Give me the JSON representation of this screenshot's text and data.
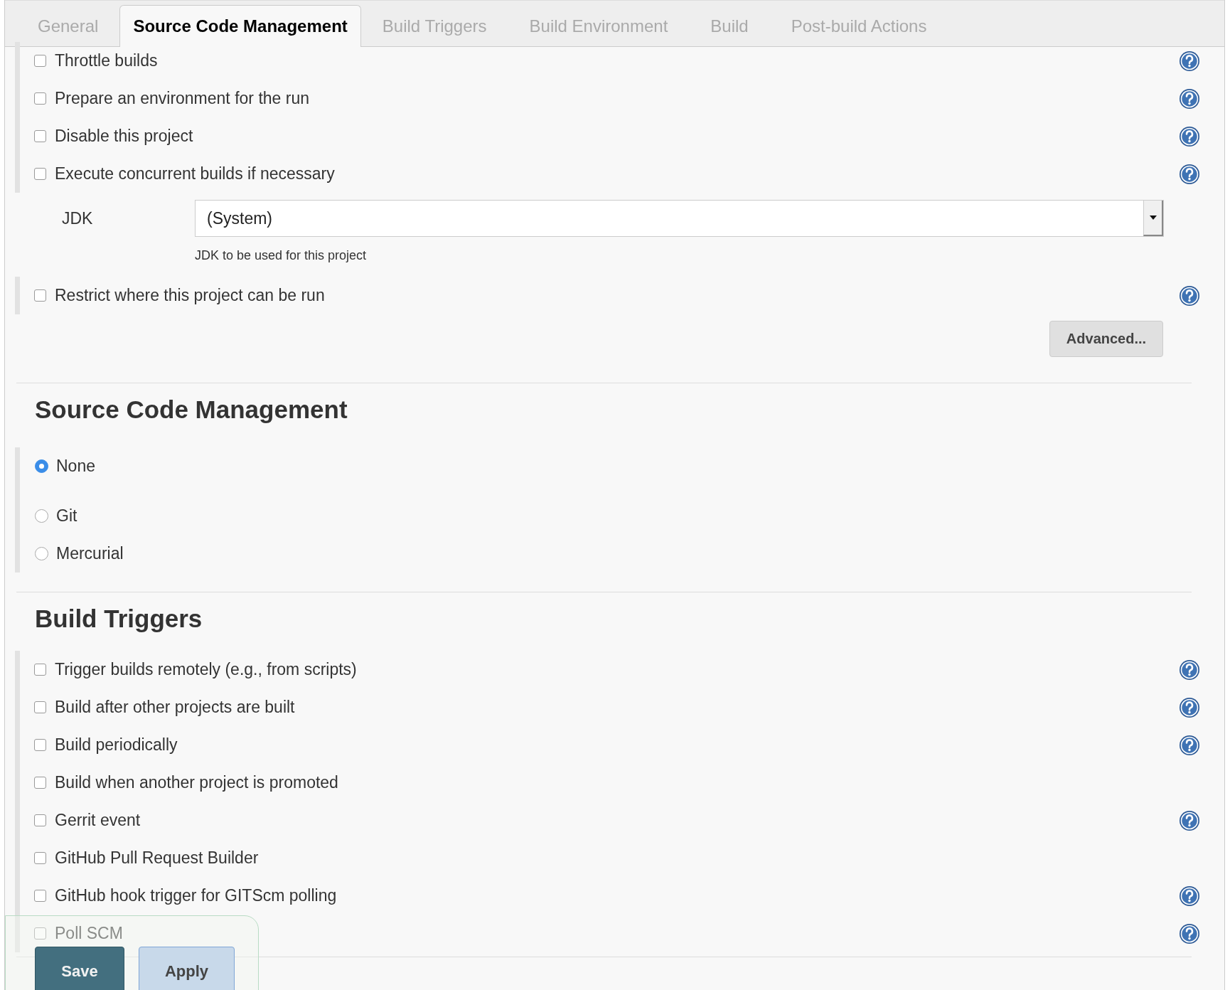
{
  "tabs": [
    {
      "label": "General",
      "selected": false
    },
    {
      "label": "Source Code Management",
      "selected": true
    },
    {
      "label": "Build Triggers",
      "selected": false
    },
    {
      "label": "Build Environment",
      "selected": false
    },
    {
      "label": "Build",
      "selected": false
    },
    {
      "label": "Post-build Actions",
      "selected": false
    }
  ],
  "general": {
    "options": [
      {
        "label": "Throttle builds",
        "checked": false,
        "help": true
      },
      {
        "label": "Prepare an environment for the run",
        "checked": false,
        "help": true
      },
      {
        "label": "Disable this project",
        "checked": false,
        "help": true
      },
      {
        "label": "Execute concurrent builds if necessary",
        "checked": false,
        "help": true
      }
    ],
    "jdk": {
      "label": "JDK",
      "value": "(System)",
      "hint": "JDK to be used for this project"
    },
    "restrict": {
      "label": "Restrict where this project can be run",
      "checked": false,
      "help": true
    },
    "advanced_button": "Advanced..."
  },
  "scm": {
    "title": "Source Code Management",
    "options": [
      {
        "label": "None",
        "selected": true
      },
      {
        "label": "Git",
        "selected": false
      },
      {
        "label": "Mercurial",
        "selected": false
      }
    ]
  },
  "triggers": {
    "title": "Build Triggers",
    "options": [
      {
        "label": "Trigger builds remotely (e.g., from scripts)",
        "checked": false,
        "help": true
      },
      {
        "label": "Build after other projects are built",
        "checked": false,
        "help": true
      },
      {
        "label": "Build periodically",
        "checked": false,
        "help": true
      },
      {
        "label": "Build when another project is promoted",
        "checked": false,
        "help": false
      },
      {
        "label": "Gerrit event",
        "checked": false,
        "help": true
      },
      {
        "label": "GitHub Pull Request Builder",
        "checked": false,
        "help": false
      },
      {
        "label": "GitHub hook trigger for GITScm polling",
        "checked": false,
        "help": true
      },
      {
        "label": "Poll SCM",
        "checked": false,
        "help": true
      }
    ]
  },
  "buttons": [
    {
      "label": "Save",
      "kind": "primary"
    },
    {
      "label": "Apply",
      "kind": "secondary"
    }
  ]
}
